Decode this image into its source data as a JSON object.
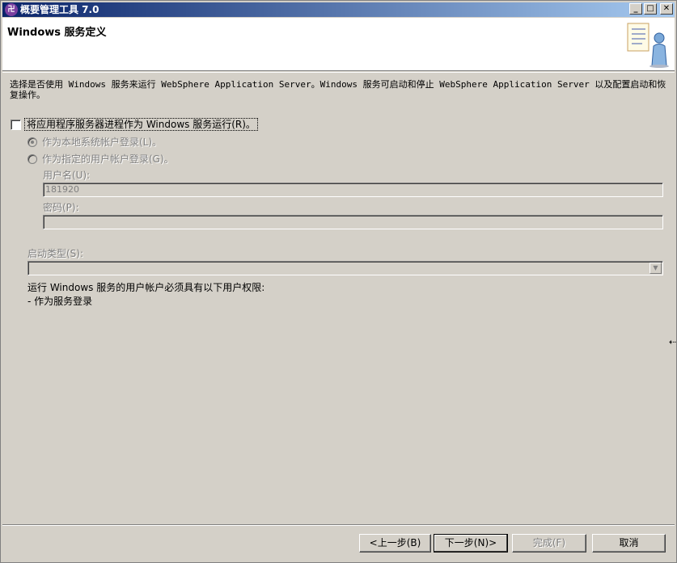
{
  "window": {
    "title": "概要管理工具 7.0",
    "icon_name": "app-icon",
    "icon_glyph": "卍"
  },
  "title_buttons": {
    "minimize": "_",
    "maximize": "□",
    "close": "✕"
  },
  "header": {
    "title": "Windows 服务定义",
    "graphic": "wizard-document-person-icon"
  },
  "description": "选择是否使用 Windows 服务来运行 WebSphere Application Server。Windows 服务可启动和停止 WebSphere Application Server 以及配置启动和恢复操作。",
  "run_as_service": {
    "label": "将应用程序服务器进程作为 Windows 服务运行(R)。",
    "checked": false
  },
  "logon": {
    "local_system_label": "作为本地系统帐户登录(L)。",
    "specified_user_label": "作为指定的用户帐户登录(G)。",
    "selected": "local_system"
  },
  "username": {
    "label": "用户名(U):",
    "value": "181920"
  },
  "password": {
    "label": "密码(P):",
    "value": ""
  },
  "startup": {
    "label": "启动类型(S):",
    "value": ""
  },
  "rights": {
    "heading": "运行 Windows 服务的用户帐户必须具有以下用户权限:",
    "items": [
      "-  作为服务登录"
    ]
  },
  "buttons": {
    "back": "<上一步(B)",
    "next": "下一步(N)>",
    "finish": "完成(F)",
    "cancel": "取消"
  },
  "cursor_glyph": "⇠"
}
